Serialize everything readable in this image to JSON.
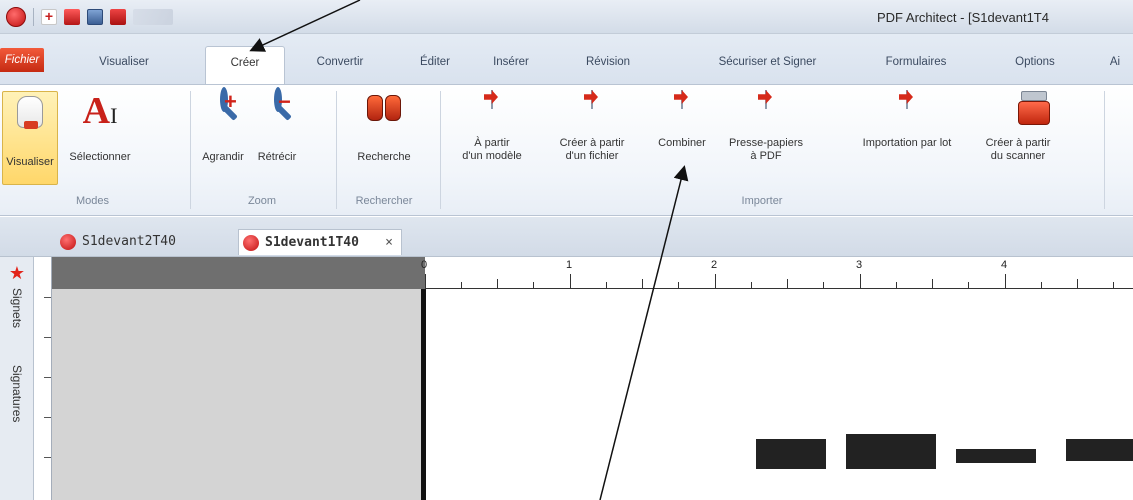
{
  "window": {
    "title": "PDF Architect - [S1devant1T4"
  },
  "tabs": {
    "file": "Fichier",
    "items": [
      {
        "label": "Visualiser"
      },
      {
        "label": "Créer"
      },
      {
        "label": "Convertir"
      },
      {
        "label": "Éditer"
      },
      {
        "label": "Insérer"
      },
      {
        "label": "Révision"
      },
      {
        "label": "Sécuriser et Signer"
      },
      {
        "label": "Formulaires"
      },
      {
        "label": "Options"
      },
      {
        "label": "Ai"
      }
    ],
    "active": "Créer"
  },
  "ribbon": {
    "groups": {
      "modes": "Modes",
      "zoom": "Zoom",
      "rechercher": "Rechercher",
      "importer": "Importer"
    },
    "buttons": {
      "visualiser": "Visualiser",
      "selectionner": "Sélectionner",
      "agrandir": "Agrandir",
      "retrecir": "Rétrécir",
      "recherche": "Recherche",
      "modele_1": "À partir",
      "modele_2": "d'un modèle",
      "fichier_1": "Créer à partir",
      "fichier_2": "d'un fichier",
      "combiner": "Combiner",
      "presse_1": "Presse-papiers",
      "presse_2": "à PDF",
      "lot": "Importation par lot",
      "scanner_1": "Créer à partir",
      "scanner_2": "du scanner"
    }
  },
  "documents": {
    "tabs": [
      {
        "label": "S1devant2T40"
      },
      {
        "label": "S1devant1T40"
      }
    ],
    "close_glyph": "×"
  },
  "side_panel": {
    "signets": "Signets",
    "signatures": "Signatures"
  },
  "ruler": {
    "marks": [
      "0",
      "1",
      "2",
      "3",
      "4"
    ]
  },
  "colors": {
    "accent_red": "#d62a1a",
    "file_tab": "#e2421f",
    "selected_button": "#ffd76a"
  }
}
